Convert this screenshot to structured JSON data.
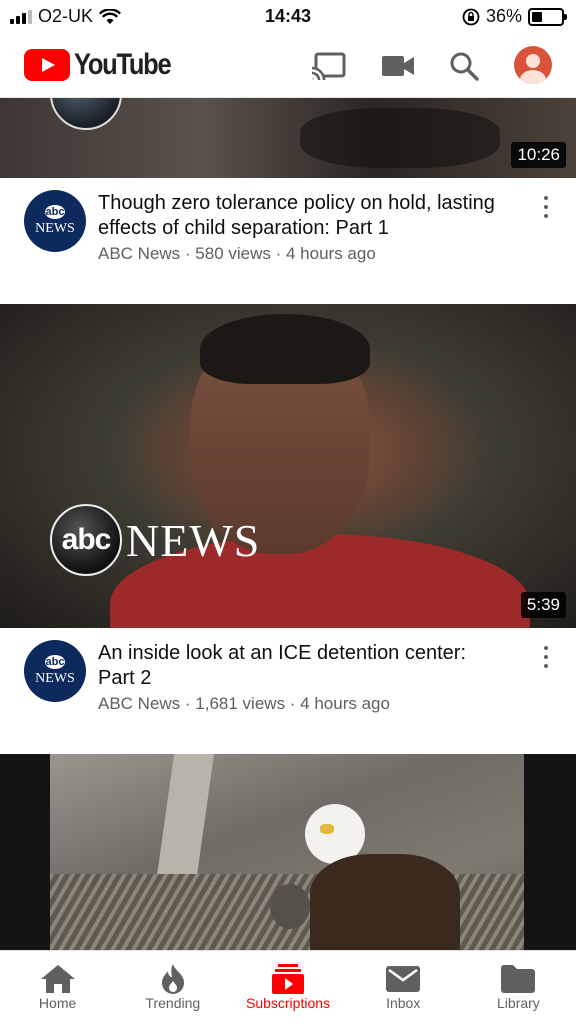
{
  "status_bar": {
    "carrier": "O2-UK",
    "time": "14:43",
    "battery": "36%",
    "battery_level": 0.36
  },
  "app_bar": {
    "logo_text": "YouTube",
    "icons": [
      "cast-icon",
      "video-camera-icon",
      "search-icon",
      "account-avatar"
    ]
  },
  "videos": [
    {
      "duration": "10:26",
      "channel_logo_top": "abc",
      "channel_logo_bottom": "NEWS",
      "title": "Though zero tolerance policy on hold, lasting effects of child separation: Part 1",
      "channel": "ABC News",
      "views": "580 views",
      "age": "4 hours ago",
      "subline": "ABC News · 580 views · 4 hours ago"
    },
    {
      "duration": "5:39",
      "channel_logo_top": "abc",
      "channel_logo_bottom": "NEWS",
      "title": "An inside look at an ICE detention center: Part 2",
      "channel": "ABC News",
      "views": "1,681 views",
      "age": "4 hours ago",
      "subline": "ABC News · 1,681 views · 4 hours ago",
      "overlay_abc": "abc",
      "overlay_news": "NEWS"
    }
  ],
  "bottom_nav": {
    "items": [
      {
        "label": "Home",
        "icon": "home-icon"
      },
      {
        "label": "Trending",
        "icon": "flame-icon"
      },
      {
        "label": "Subscriptions",
        "icon": "subscriptions-icon",
        "active": true
      },
      {
        "label": "Inbox",
        "icon": "mail-icon"
      },
      {
        "label": "Library",
        "icon": "folder-icon"
      }
    ]
  },
  "colors": {
    "brand_red": "#ff0000",
    "text_primary": "#0f0f0f",
    "text_secondary": "#606060"
  }
}
